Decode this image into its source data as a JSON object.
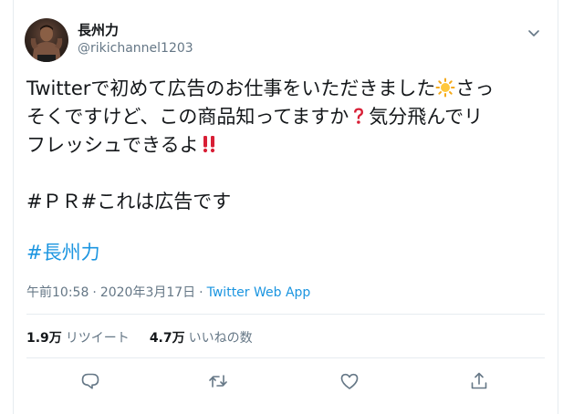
{
  "tweet": {
    "author": {
      "display_name": "長州力",
      "handle": "@rikichannel1203"
    },
    "text": {
      "line1_a": "Twitterで初めて広告のお仕事をいただきました",
      "line1_b": "さっ",
      "line2_a": "そくですけど、この商品知ってますか",
      "line2_b": "気分飛んでリ",
      "line3_a": "フレッシュできるよ",
      "line5": "#ＰＲ#これは広告です"
    },
    "hashtag": "#長州力",
    "emoji": {
      "sun": "sun-emoji",
      "question": "red-question-emoji",
      "exclaim": "double-exclamation-emoji"
    },
    "meta": {
      "time": "午前10:58",
      "separator": "·",
      "date": "2020年3月17日",
      "source": "Twitter Web App"
    },
    "stats": {
      "retweets_count": "1.9万",
      "retweets_label": "リツイート",
      "likes_count": "4.7万",
      "likes_label": "いいねの数"
    },
    "icons": {
      "more": "chevron-down-icon",
      "reply": "reply-icon",
      "retweet": "retweet-icon",
      "like": "heart-icon",
      "share": "share-icon"
    },
    "colors": {
      "link": "#1b95e0",
      "secondary": "#657786",
      "text": "#14171a",
      "divider": "#e6ecf0"
    }
  }
}
